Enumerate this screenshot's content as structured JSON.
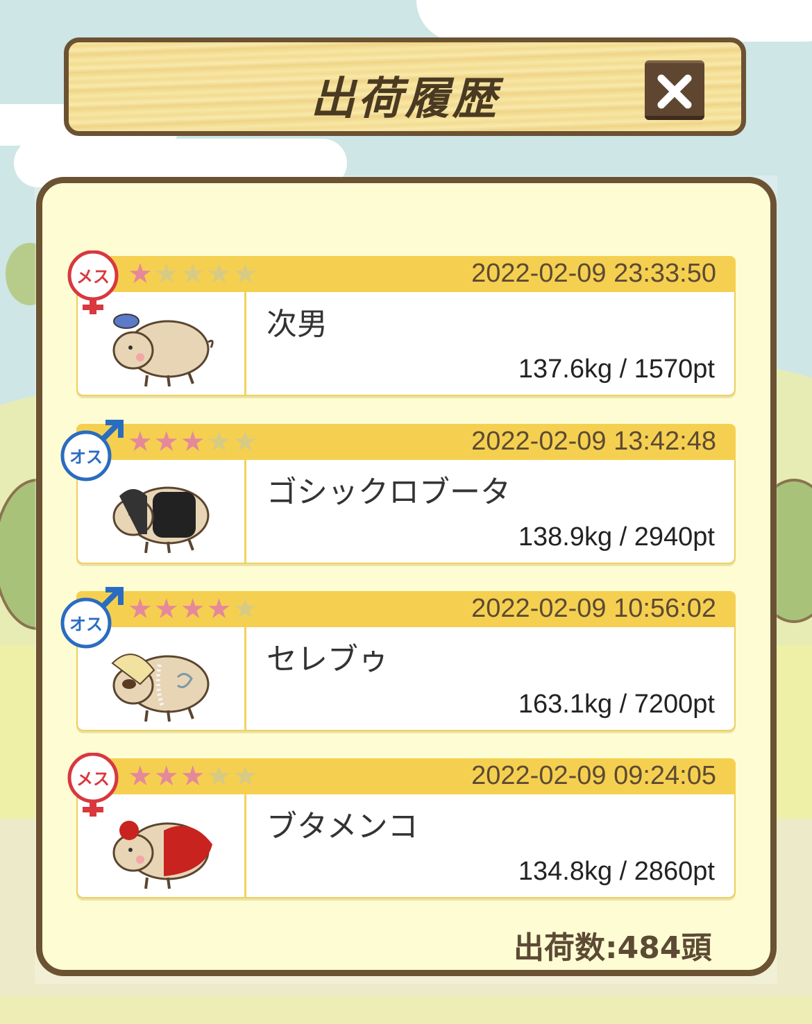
{
  "header": {
    "title": "出荷履歴",
    "close_icon": "close-icon"
  },
  "colors": {
    "board_border": "#6b5233",
    "panel_bg": "#fefcd3",
    "row_header": "#f5d050",
    "star_on": "#e5899a",
    "star_off": "#d7ca85",
    "female": "#d8383e",
    "male": "#2a6cc0"
  },
  "records": [
    {
      "gender": "メス",
      "stars_total": 5,
      "stars_filled": 1,
      "datetime": "2022-02-09 23:33:50",
      "name": "次男",
      "stats": "137.6kg / 1570pt"
    },
    {
      "gender": "オス",
      "stars_total": 5,
      "stars_filled": 3,
      "datetime": "2022-02-09 13:42:48",
      "name": "ゴシックロブータ",
      "stats": "138.9kg / 2940pt"
    },
    {
      "gender": "オス",
      "stars_total": 5,
      "stars_filled": 4,
      "datetime": "2022-02-09 10:56:02",
      "name": "セレブゥ",
      "stats": "163.1kg / 7200pt"
    },
    {
      "gender": "メス",
      "stars_total": 5,
      "stars_filled": 3,
      "datetime": "2022-02-09 09:24:05",
      "name": "ブタメンコ",
      "stats": "134.8kg / 2860pt"
    }
  ],
  "footer": {
    "total": "出荷数:484頭"
  }
}
